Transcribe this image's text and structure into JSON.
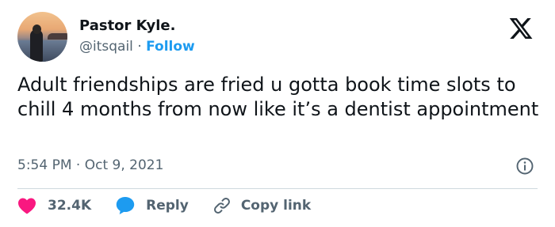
{
  "author": {
    "name": "Pastor Kyle.",
    "handle": "@itsqail",
    "separator": "·",
    "follow_label": "Follow"
  },
  "tweet": {
    "text": "Adult friendships are fried u gotta book time slots to chill 4 months from now like it’s a dentist appointment",
    "time": "5:54 PM",
    "date": "Oct 9, 2021"
  },
  "actions": {
    "likes": "32.4K",
    "reply_label": "Reply",
    "copy_link_label": "Copy link"
  },
  "colors": {
    "like": "#f91880",
    "reply": "#1d9bf0",
    "follow": "#1d9bf0",
    "secondary_text": "#536471"
  },
  "icons": [
    "x-logo-icon",
    "info-icon",
    "heart-icon",
    "reply-bubble-icon",
    "link-icon"
  ]
}
